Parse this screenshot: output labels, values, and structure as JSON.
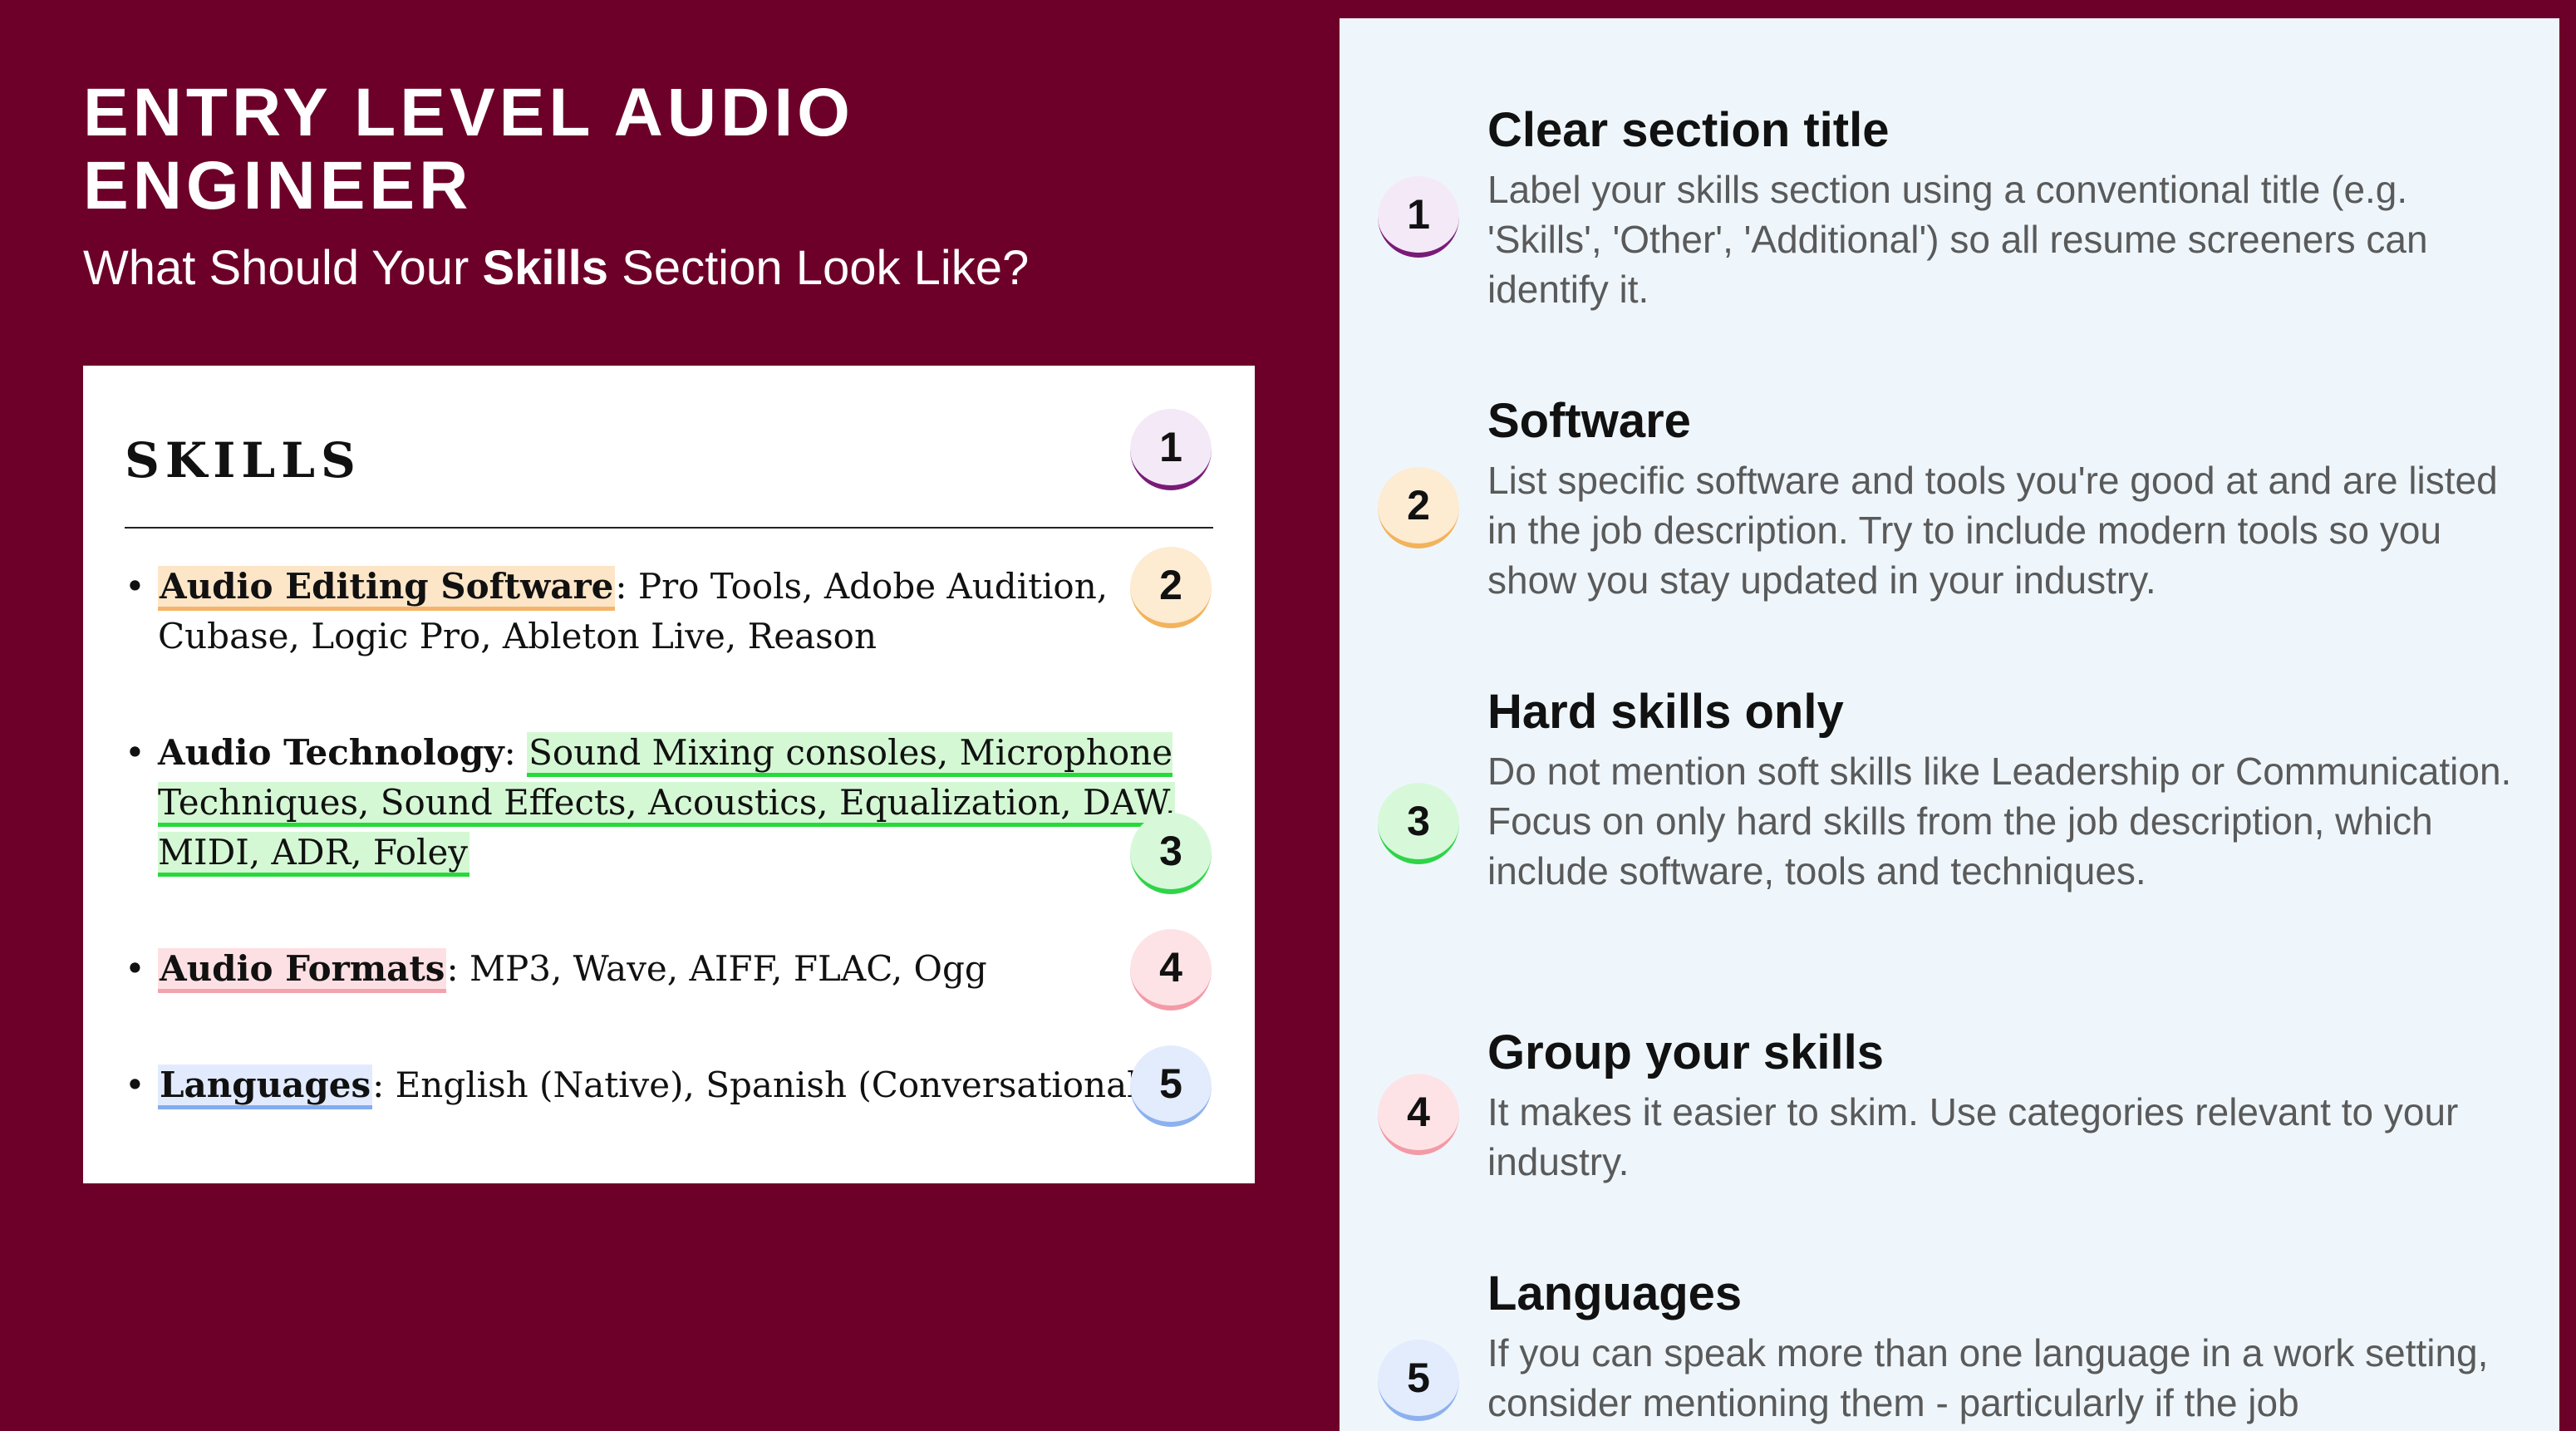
{
  "header": {
    "title": "ENTRY LEVEL AUDIO ENGINEER",
    "subtitle_pre": "What Should Your ",
    "subtitle_bold": "Skills",
    "subtitle_post": " Section Look Like?"
  },
  "card": {
    "heading": "SKILLS",
    "items": [
      {
        "label": "Audio Editing Software",
        "text": ": Pro Tools, Adobe Audition, Cubase, Logic Pro, Ableton Live, Reason"
      },
      {
        "label": "Audio Technology",
        "sep": ": ",
        "highlight": "Sound Mixing consoles, Microphone Techniques, Sound Effects, Acoustics, Equalization, DAW, MIDI, ADR, Foley"
      },
      {
        "label": "Audio Formats",
        "text": ": MP3, Wave, AIFF, FLAC, Ogg"
      },
      {
        "label": "Languages",
        "text": ": English (Native), Spanish (Conversational)"
      }
    ],
    "badges": [
      "1",
      "2",
      "3",
      "4",
      "5"
    ]
  },
  "tips": [
    {
      "num": "1",
      "title": "Clear section title",
      "body": "Label your skills section using a conventional title (e.g. 'Skills', 'Other', 'Additional') so all resume screeners can identify it."
    },
    {
      "num": "2",
      "title": "Software",
      "body": "List specific software and tools you're good at and are listed in the job description. Try to include modern tools so you show you stay updated in your industry."
    },
    {
      "num": "3",
      "title": "Hard skills only",
      "body": "Do not mention soft skills like Leadership or Communication. Focus on only hard skills from the job description, which include software, tools and techniques."
    },
    {
      "num": "4",
      "title": "Group your skills",
      "body": "It makes it easier to skim. Use categories relevant to your industry."
    },
    {
      "num": "5",
      "title": "Languages",
      "body": "If you can speak more than one language in a work setting, consider mentioning them - particularly if the job"
    }
  ],
  "colors": {
    "background": "#6d0029",
    "panel": "#eef6fc",
    "badge1": "#7a1a78",
    "badge2": "#f2b35b",
    "badge3": "#2fd448",
    "badge4": "#f39aa6",
    "badge5": "#8db0ee"
  }
}
